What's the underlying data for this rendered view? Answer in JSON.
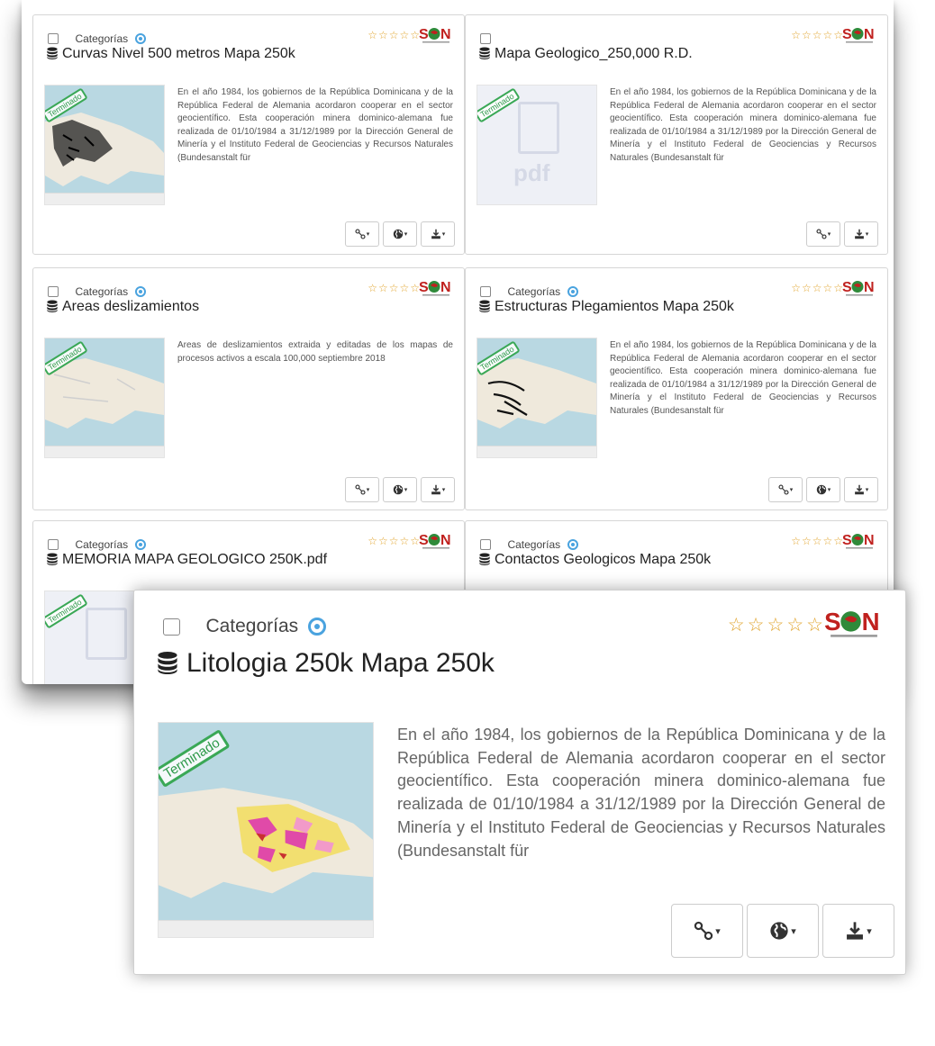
{
  "common": {
    "category_label": "Categorías",
    "stars": "☆☆☆☆☆",
    "badge": "Terminado",
    "logo_text": "SGN",
    "pdf_placeholder": "pdf"
  },
  "icons": {
    "share": "share-icon",
    "globe": "globe-icon",
    "download": "download-icon",
    "database": "database-icon",
    "caret": "▾"
  },
  "colors": {
    "badge_green": "#3aa856",
    "star_gold": "#e1a32a",
    "logo_red": "#c0211e",
    "category_blue": "#4aa3df"
  },
  "cards": [
    {
      "title": "Curvas Nivel 500 metros Mapa 250k",
      "description": "En el año 1984, los gobiernos de la República Dominicana y de la República Federal de Alemania acordaron cooperar en el sector geocientífico. Esta cooperación minera dominico-alemana fue realizada de 01/10/1984 a 31/12/1989 por la Dirección General de Minería y el Instituto Federal de Geociencias y Recursos Naturales (Bundesanstalt für",
      "buttons": [
        "share",
        "globe",
        "download"
      ]
    },
    {
      "title": "Mapa Geologico_250,000 R.D.",
      "description": "En el año 1984, los gobiernos de la República Dominicana y de la República Federal de Alemania acordaron cooperar en el sector geocientífico. Esta cooperación minera dominico-alemana fue realizada de 01/10/1984 a 31/12/1989 por la Dirección General de Minería y el Instituto Federal de Geociencias y Recursos Naturales (Bundesanstalt für",
      "buttons": [
        "share",
        "download"
      ]
    },
    {
      "title": "Areas deslizamientos",
      "description": "Areas de deslizamientos extraida y editadas de los mapas de procesos activos a escala 100,000 septiembre 2018",
      "buttons": [
        "share",
        "globe",
        "download"
      ]
    },
    {
      "title": "Estructuras Plegamientos Mapa 250k",
      "description": "En el año 1984, los gobiernos de la República Dominicana y de la República Federal de Alemania acordaron cooperar en el sector geocientífico. Esta cooperación minera dominico-alemana fue realizada de 01/10/1984 a 31/12/1989 por la Dirección General de Minería y el Instituto Federal de Geociencias y Recursos Naturales (Bundesanstalt für",
      "buttons": [
        "share",
        "globe",
        "download"
      ]
    },
    {
      "title": "MEMORIA MAPA GEOLOGICO 250K.pdf"
    },
    {
      "title": "Contactos Geologicos Mapa 250k"
    }
  ],
  "zoomed_card": {
    "title": "Litologia 250k Mapa 250k",
    "description": "En el año 1984, los gobiernos de la República Dominicana y de la República Federal de Alemania acordaron cooperar en el sector geocientífico. Esta cooperación minera dominico-alemana fue realizada de 01/10/1984 a 31/12/1989 por la Dirección General de Minería y el Instituto Federal de Geociencias y Recursos Naturales (Bundesanstalt für",
    "buttons": [
      "share",
      "globe",
      "download"
    ]
  }
}
